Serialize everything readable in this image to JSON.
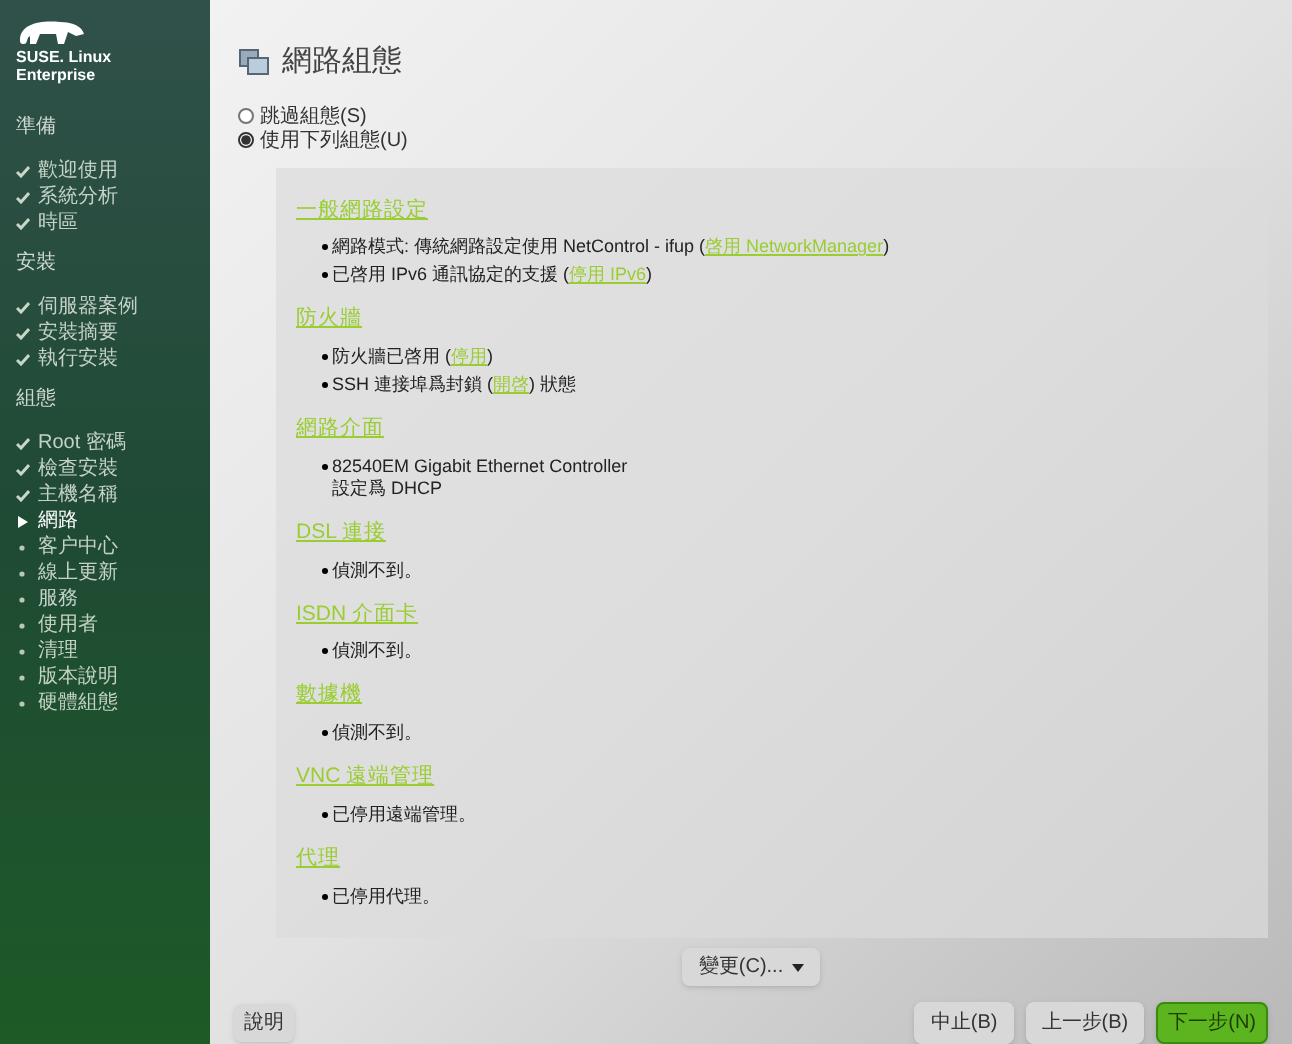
{
  "sidebar": {
    "logo_text": [
      "SUSE. Linux",
      "Enterprise"
    ],
    "groups": [
      {
        "title": "準備",
        "items": [
          {
            "label": "歡迎使用",
            "kind": "done"
          },
          {
            "label": "系統分析",
            "kind": "done"
          },
          {
            "label": "時區",
            "kind": "done"
          }
        ]
      },
      {
        "title": "安裝",
        "items": [
          {
            "label": "伺服器案例",
            "kind": "done"
          },
          {
            "label": "安裝摘要",
            "kind": "done"
          },
          {
            "label": "執行安裝",
            "kind": "done"
          }
        ]
      },
      {
        "title": "組態",
        "items": [
          {
            "label": "Root 密碼",
            "kind": "done"
          },
          {
            "label": "檢查安裝",
            "kind": "done"
          },
          {
            "label": "主機名稱",
            "kind": "done"
          },
          {
            "label": "網路",
            "kind": "current"
          },
          {
            "label": "客户中心",
            "kind": "pending"
          },
          {
            "label": "線上更新",
            "kind": "pending"
          },
          {
            "label": "服務",
            "kind": "pending"
          },
          {
            "label": "使用者",
            "kind": "pending"
          },
          {
            "label": "清理",
            "kind": "pending"
          },
          {
            "label": "版本說明",
            "kind": "pending"
          },
          {
            "label": "硬體組態",
            "kind": "pending"
          }
        ]
      }
    ]
  },
  "title": "網路組態",
  "options": [
    {
      "label": "跳過組態(S)",
      "selected": false
    },
    {
      "label": "使用下列組態(U)",
      "selected": true
    }
  ],
  "sections": [
    {
      "heading": "一般網路設定",
      "items": [
        {
          "lines": [
            [
              {
                "text": "網路模式: 傳統網路設定使用 NetControl - ifup ("
              },
              {
                "text": "啓用 NetworkManager",
                "link": true
              },
              {
                "text": ")"
              }
            ]
          ]
        },
        {
          "lines": [
            [
              {
                "text": "已啓用 IPv6 通訊協定的支援 ("
              },
              {
                "text": "停用 IPv6",
                "link": true
              },
              {
                "text": ")"
              }
            ]
          ]
        }
      ]
    },
    {
      "heading": "防火牆",
      "items": [
        {
          "lines": [
            [
              {
                "text": "防火牆已啓用 ("
              },
              {
                "text": "停用",
                "link": true
              },
              {
                "text": ")"
              }
            ]
          ]
        },
        {
          "lines": [
            [
              {
                "text": "SSH 連接埠爲封鎖 ("
              },
              {
                "text": "開啓",
                "link": true
              },
              {
                "text": ") 狀態"
              }
            ]
          ]
        }
      ]
    },
    {
      "heading": "網路介面",
      "items": [
        {
          "lines": [
            [
              {
                "text": "82540EM Gigabit Ethernet Controller"
              }
            ],
            [
              {
                "text": "設定爲 DHCP"
              }
            ]
          ]
        }
      ]
    },
    {
      "heading": "DSL 連接",
      "items": [
        {
          "lines": [
            [
              {
                "text": "偵測不到。"
              }
            ]
          ]
        }
      ]
    },
    {
      "heading": "ISDN 介面卡",
      "items": [
        {
          "lines": [
            [
              {
                "text": "偵測不到。"
              }
            ]
          ]
        }
      ]
    },
    {
      "heading": "數據機",
      "items": [
        {
          "lines": [
            [
              {
                "text": "偵測不到。"
              }
            ]
          ]
        }
      ]
    },
    {
      "heading": "VNC 遠端管理",
      "items": [
        {
          "lines": [
            [
              {
                "text": "已停用遠端管理。"
              }
            ]
          ]
        }
      ]
    },
    {
      "heading": "代理",
      "items": [
        {
          "lines": [
            [
              {
                "text": "已停用代理。"
              }
            ]
          ]
        }
      ]
    }
  ],
  "change_button": "變更(C)...",
  "help_button": "說明",
  "nav_buttons": [
    {
      "label": "中止(B)",
      "primary": false
    },
    {
      "label": "上一步(B)",
      "primary": false
    },
    {
      "label": "下一步(N)",
      "primary": true
    }
  ]
}
